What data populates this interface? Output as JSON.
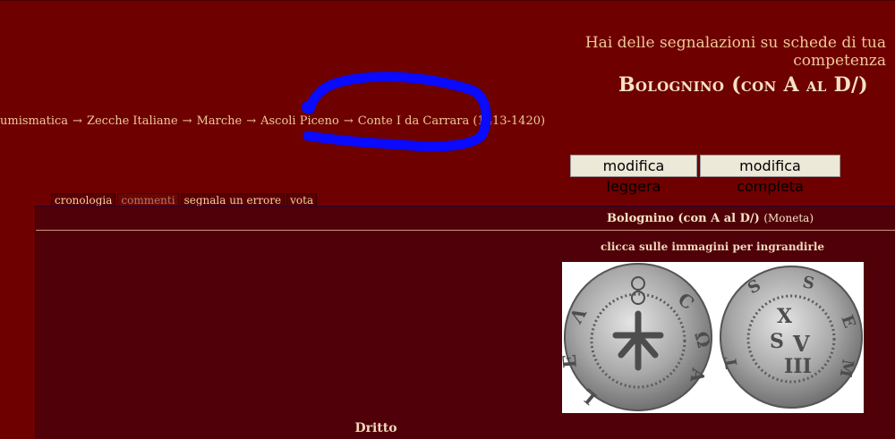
{
  "header": {
    "notice": "Hai delle segnalazioni su schede di tua competenza",
    "coin_title": "Bolognino (con A al D/)"
  },
  "breadcrumb": {
    "items": [
      "umismatica",
      "Zecche Italiane",
      "Marche",
      "Ascoli Piceno",
      "Conte I da Carrara (1413-1420)"
    ],
    "separator": "→"
  },
  "actions": {
    "light_edit": "modifica leggera",
    "full_edit": "modifica completa"
  },
  "tabs": [
    {
      "label": "cronologia",
      "enabled": true
    },
    {
      "label": "commenti",
      "enabled": false
    },
    {
      "label": "segnala un errore",
      "enabled": true
    },
    {
      "label": "vota",
      "enabled": true
    }
  ],
  "panel": {
    "title": "Bolognino (con A al D/)",
    "type": "(Moneta)",
    "hint": "clicca sulle immagini per ingrandirle",
    "dritto_label": "Dritto"
  },
  "colors": {
    "background": "#6e0000",
    "panel": "#500008",
    "text": "#f0c89a",
    "annotation": "#0a0aff"
  }
}
